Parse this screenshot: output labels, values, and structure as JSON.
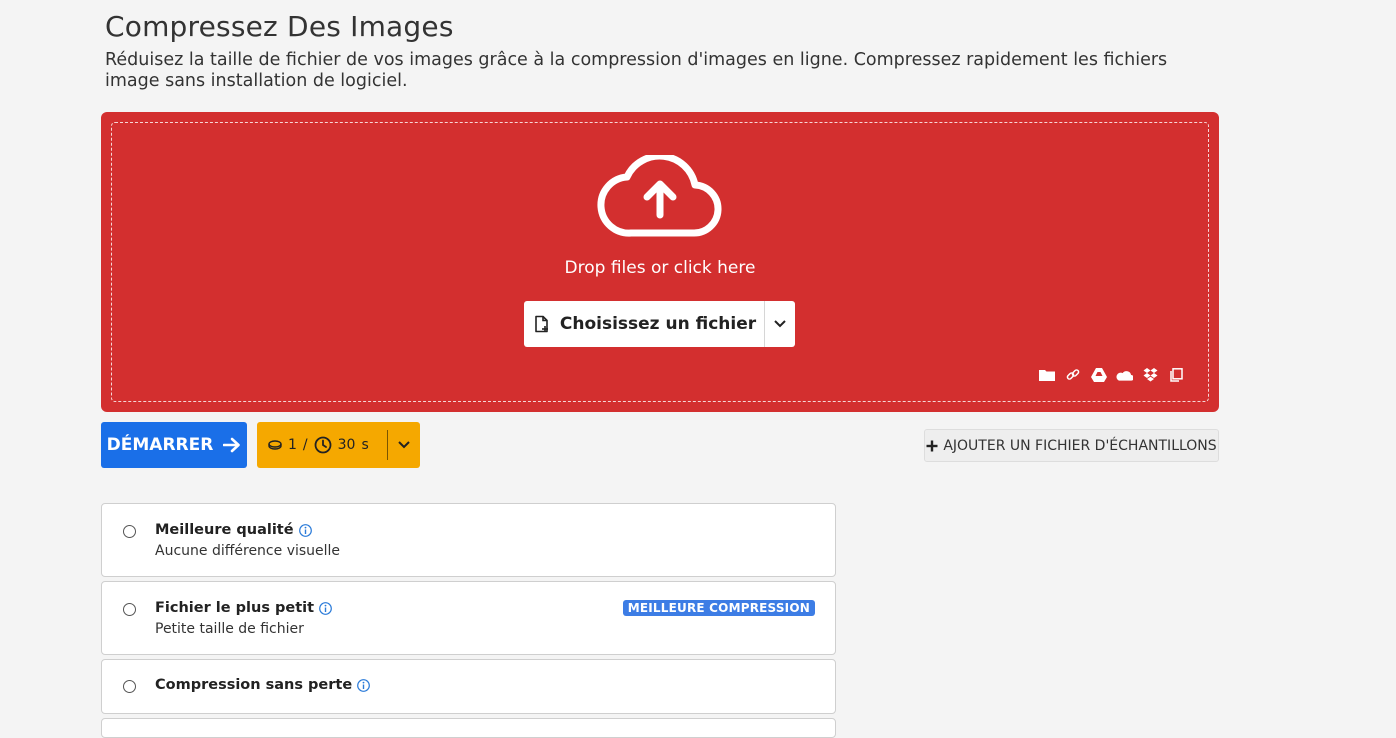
{
  "page": {
    "title": "Compressez Des Images",
    "subtitle": "Réduisez la taille de fichier de vos images grâce à la compression d'images en ligne. Compressez rapidement les fichiers image sans installation de logiciel."
  },
  "dropzone": {
    "text": "Drop files or click here",
    "choose_label": "Choisissez un fichier",
    "background_color": "#d32f2f",
    "source_icons": [
      "folder-icon",
      "link-icon",
      "google-drive-icon",
      "onedrive-icon",
      "dropbox-icon",
      "clipboard-icon"
    ]
  },
  "actions": {
    "start_label": "DÉMARRER",
    "credits": "1",
    "credits_sep": "/",
    "time": "30",
    "time_unit": "s",
    "sample_label": "AJOUTER UN FICHIER D'ÉCHANTILLONS"
  },
  "options": [
    {
      "title": "Meilleure qualité",
      "desc": "Aucune différence visuelle",
      "badge": ""
    },
    {
      "title": "Fichier le plus petit",
      "desc": "Petite taille de fichier",
      "badge": "MEILLEURE COMPRESSION"
    },
    {
      "title": "Compression sans perte",
      "desc": "",
      "badge": ""
    }
  ],
  "colors": {
    "primary": "#1a6fe8",
    "accent": "#f5a800",
    "badge": "#3d7de5"
  }
}
